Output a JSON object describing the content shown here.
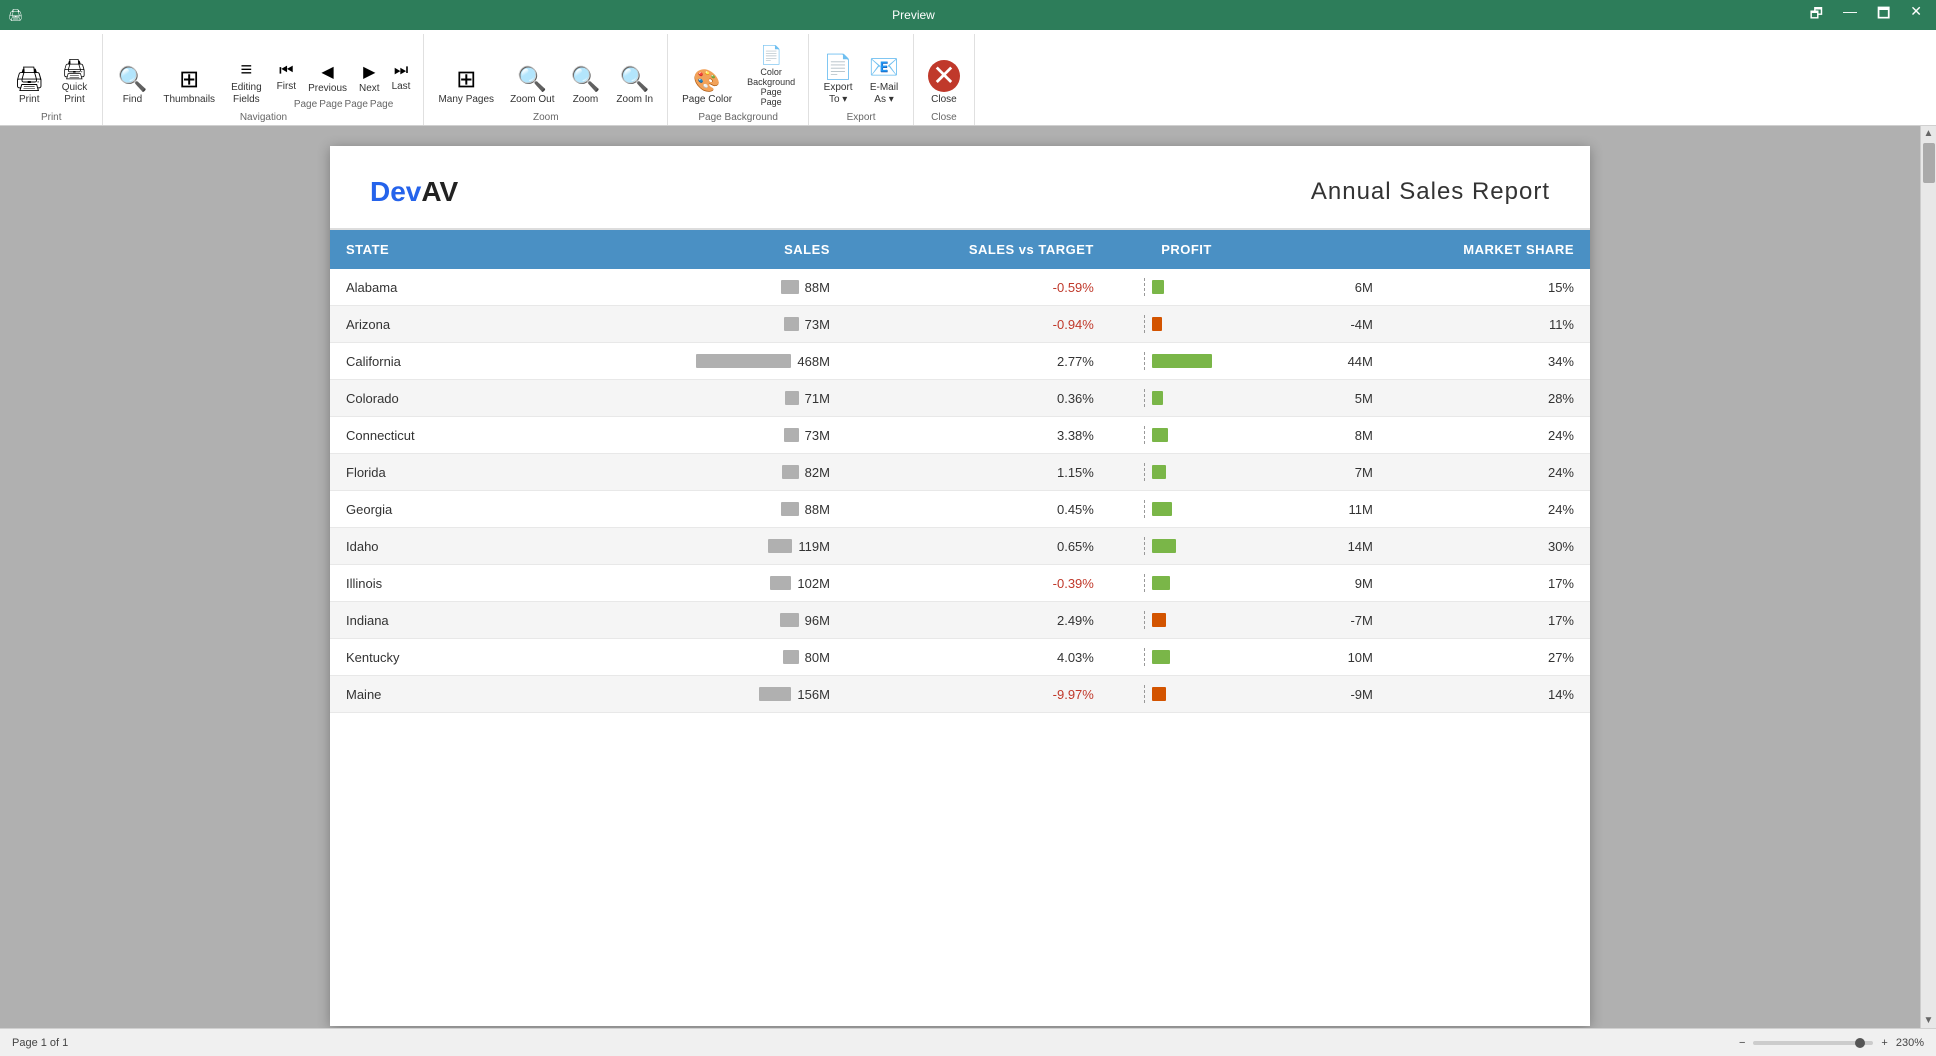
{
  "titleBar": {
    "appIcon": "🖨",
    "title": "Preview",
    "buttons": [
      "🗗",
      "—",
      "🗖",
      "✕"
    ]
  },
  "ribbon": {
    "groups": [
      {
        "label": "Print",
        "buttons": [
          {
            "id": "print",
            "icon": "🖨",
            "label": "Print"
          },
          {
            "id": "quick-print",
            "icon": "🖨",
            "label": "Quick\nPrint"
          }
        ]
      },
      {
        "label": "Navigation",
        "buttons": [
          {
            "id": "find",
            "icon": "🔍",
            "label": "Find"
          },
          {
            "id": "thumbnails",
            "icon": "⊞",
            "label": "Thumbnails"
          },
          {
            "id": "editing-fields",
            "icon": "≡",
            "label": "Editing\nFields"
          },
          {
            "id": "first-page",
            "icon": "⏮",
            "label": "First\nPage"
          },
          {
            "id": "previous-page",
            "icon": "◀",
            "label": "Previous\nPage"
          },
          {
            "id": "next-page",
            "icon": "▶",
            "label": "Next\nPage"
          },
          {
            "id": "last-page",
            "icon": "⏭",
            "label": "Last\nPage"
          }
        ]
      },
      {
        "label": "Zoom",
        "buttons": [
          {
            "id": "many-pages",
            "icon": "⊞",
            "label": "Many Pages"
          },
          {
            "id": "zoom-out",
            "icon": "🔍",
            "label": "Zoom Out"
          },
          {
            "id": "zoom",
            "icon": "🔍",
            "label": "Zoom"
          },
          {
            "id": "zoom-in",
            "icon": "🔍",
            "label": "Zoom In"
          }
        ]
      },
      {
        "label": "Page Background",
        "buttons": [
          {
            "id": "page-color",
            "icon": "🎨",
            "label": "Page Color"
          },
          {
            "id": "color-background-page",
            "icon": "📄",
            "label": "Color\nBackground\nPage\nPage"
          }
        ]
      },
      {
        "label": "Export",
        "buttons": [
          {
            "id": "export-to",
            "icon": "📄",
            "label": "Export\nTo"
          },
          {
            "id": "email-as",
            "icon": "📧",
            "label": "E-Mail\nAs"
          }
        ]
      },
      {
        "label": "Close",
        "buttons": [
          {
            "id": "close",
            "icon": "✕",
            "label": "Close",
            "style": "red"
          }
        ]
      }
    ]
  },
  "document": {
    "logo": {
      "dev": "Dev",
      "av": "AV"
    },
    "title": "Annual  Sales  Report",
    "table": {
      "headers": [
        "STATE",
        "SALES",
        "",
        "SALES vs TARGET",
        "PROFIT",
        "",
        "MARKET SHARE"
      ],
      "rows": [
        {
          "state": "Alabama",
          "sales": "88M",
          "salesBar": 18,
          "vsTarget": "-0.59%",
          "vsNeg": true,
          "profitBar": 12,
          "profitNeg": false,
          "profit": "6M",
          "share": "15%"
        },
        {
          "state": "Arizona",
          "sales": "73M",
          "salesBar": 15,
          "vsTarget": "-0.94%",
          "vsNeg": true,
          "profitBar": 10,
          "profitNeg": true,
          "profit": "-4M",
          "share": "11%"
        },
        {
          "state": "California",
          "sales": "468M",
          "salesBar": 95,
          "vsTarget": "2.77%",
          "vsNeg": false,
          "profitBar": 60,
          "profitNeg": false,
          "profit": "44M",
          "share": "34%"
        },
        {
          "state": "Colorado",
          "sales": "71M",
          "salesBar": 14,
          "vsTarget": "0.36%",
          "vsNeg": false,
          "profitBar": 11,
          "profitNeg": false,
          "profit": "5M",
          "share": "28%"
        },
        {
          "state": "Connecticut",
          "sales": "73M",
          "salesBar": 15,
          "vsTarget": "3.38%",
          "vsNeg": false,
          "profitBar": 16,
          "profitNeg": false,
          "profit": "8M",
          "share": "24%"
        },
        {
          "state": "Florida",
          "sales": "82M",
          "salesBar": 17,
          "vsTarget": "1.15%",
          "vsNeg": false,
          "profitBar": 14,
          "profitNeg": false,
          "profit": "7M",
          "share": "24%"
        },
        {
          "state": "Georgia",
          "sales": "88M",
          "salesBar": 18,
          "vsTarget": "0.45%",
          "vsNeg": false,
          "profitBar": 20,
          "profitNeg": false,
          "profit": "11M",
          "share": "24%"
        },
        {
          "state": "Idaho",
          "sales": "119M",
          "salesBar": 24,
          "vsTarget": "0.65%",
          "vsNeg": false,
          "profitBar": 24,
          "profitNeg": false,
          "profit": "14M",
          "share": "30%"
        },
        {
          "state": "Illinois",
          "sales": "102M",
          "salesBar": 21,
          "vsTarget": "-0.39%",
          "vsNeg": true,
          "profitBar": 18,
          "profitNeg": false,
          "profit": "9M",
          "share": "17%"
        },
        {
          "state": "Indiana",
          "sales": "96M",
          "salesBar": 19,
          "vsTarget": "2.49%",
          "vsNeg": false,
          "profitBar": 14,
          "profitNeg": true,
          "profit": "-7M",
          "share": "17%"
        },
        {
          "state": "Kentucky",
          "sales": "80M",
          "salesBar": 16,
          "vsTarget": "4.03%",
          "vsNeg": false,
          "profitBar": 18,
          "profitNeg": false,
          "profit": "10M",
          "share": "27%"
        },
        {
          "state": "Maine",
          "sales": "156M",
          "salesBar": 32,
          "vsTarget": "-9.97%",
          "vsNeg": true,
          "profitBar": 14,
          "profitNeg": true,
          "profit": "-9M",
          "share": "14%"
        }
      ]
    }
  },
  "statusBar": {
    "pageInfo": "Page 1 of 1",
    "zoom": "230%"
  }
}
